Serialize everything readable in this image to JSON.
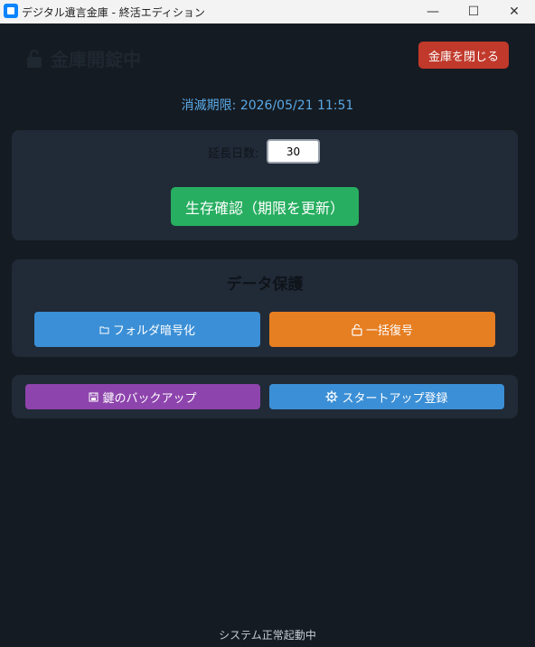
{
  "window": {
    "title": "デジタル遺言金庫 - 終活エディション",
    "minimize_glyph": "—",
    "maximize_glyph": "☐",
    "close_glyph": "✕"
  },
  "header": {
    "lock_status": "金庫開錠中",
    "close_vault_label": "金庫を閉じる"
  },
  "expiry": {
    "text": "消滅期限: 2026/05/21 11:51"
  },
  "extension": {
    "label": "延長日数:",
    "days_value": "30",
    "survival_button_label": "生存確認（期限を更新）"
  },
  "data_protection": {
    "title": "データ保護",
    "encrypt_label": "フォルダ暗号化",
    "decrypt_label": "一括復号",
    "icons": {
      "encrypt": "folder-icon",
      "decrypt": "unlock-icon"
    }
  },
  "tools": {
    "backup_label": "鍵のバックアップ",
    "startup_label": "スタートアップ登録",
    "icons": {
      "backup": "floppy-disk-icon",
      "startup": "gear-icon"
    }
  },
  "status": {
    "text": "システム正常起動中"
  },
  "colors": {
    "background": "#151b22",
    "card": "#212a37",
    "danger": "#c0392b",
    "success": "#27ae60",
    "primary": "#3b8fd6",
    "warning": "#e67e22",
    "purple": "#8e44ad",
    "expiry_text": "#5aa9e6"
  }
}
